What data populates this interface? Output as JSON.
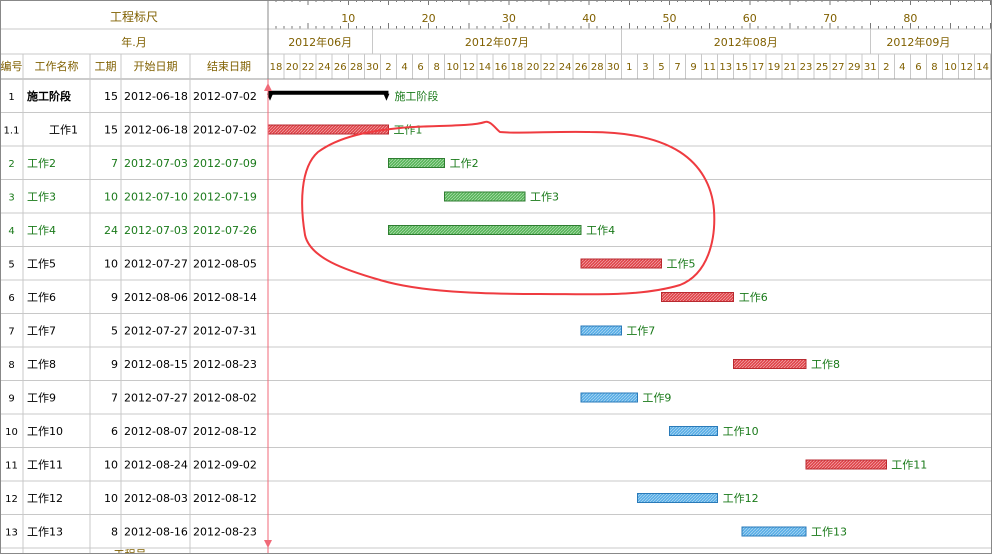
{
  "header": {
    "ruler_label": "工程标尺",
    "year_month_label": "年.月",
    "columns": [
      "编号",
      "工作名称",
      "工期",
      "开始日期",
      "结束日期"
    ]
  },
  "timeline": {
    "start_date": "2012-06-18",
    "ruler_ticks": [
      "10",
      "20",
      "30",
      "40",
      "50",
      "60",
      "70",
      "80"
    ],
    "months": [
      {
        "label": "2012年06月",
        "start": "2012-06-18",
        "end": "2012-06-30"
      },
      {
        "label": "2012年07月",
        "start": "2012-07-01",
        "end": "2012-07-31"
      },
      {
        "label": "2012年08月",
        "start": "2012-08-01",
        "end": "2012-08-31"
      },
      {
        "label": "2012年09月",
        "start": "2012-09-01",
        "end": "2012-09-12"
      }
    ]
  },
  "colors": {
    "header_text": "#806000",
    "critical": "#e0454b",
    "noncritical_green": "#58b65a",
    "free_blue": "#5aaee6",
    "summary": "#000000",
    "highlight_text": "#1a7a1a",
    "annotation": "#ef3b40",
    "grid": "#c8c8c8"
  },
  "chart_data": {
    "type": "gantt",
    "tasks": [
      {
        "id": "1",
        "name": "施工阶段",
        "duration": "15",
        "start": "2012-06-18",
        "end": "2012-07-02",
        "kind": "summary"
      },
      {
        "id": "1.1",
        "name": "工作1",
        "duration": "15",
        "start": "2012-06-18",
        "end": "2012-07-02",
        "kind": "critical"
      },
      {
        "id": "2",
        "name": "工作2",
        "duration": "7",
        "start": "2012-07-03",
        "end": "2012-07-09",
        "kind": "green"
      },
      {
        "id": "3",
        "name": "工作3",
        "duration": "10",
        "start": "2012-07-10",
        "end": "2012-07-19",
        "kind": "green"
      },
      {
        "id": "4",
        "name": "工作4",
        "duration": "24",
        "start": "2012-07-03",
        "end": "2012-07-26",
        "kind": "green"
      },
      {
        "id": "5",
        "name": "工作5",
        "duration": "10",
        "start": "2012-07-27",
        "end": "2012-08-05",
        "kind": "critical"
      },
      {
        "id": "6",
        "name": "工作6",
        "duration": "9",
        "start": "2012-08-06",
        "end": "2012-08-14",
        "kind": "critical"
      },
      {
        "id": "7",
        "name": "工作7",
        "duration": "5",
        "start": "2012-07-27",
        "end": "2012-07-31",
        "kind": "blue"
      },
      {
        "id": "8",
        "name": "工作8",
        "duration": "9",
        "start": "2012-08-15",
        "end": "2012-08-23",
        "kind": "critical"
      },
      {
        "id": "9",
        "name": "工作9",
        "duration": "7",
        "start": "2012-07-27",
        "end": "2012-08-02",
        "kind": "blue"
      },
      {
        "id": "10",
        "name": "工作10",
        "duration": "6",
        "start": "2012-08-07",
        "end": "2012-08-12",
        "kind": "blue"
      },
      {
        "id": "11",
        "name": "工作11",
        "duration": "10",
        "start": "2012-08-24",
        "end": "2012-09-02",
        "kind": "critical"
      },
      {
        "id": "12",
        "name": "工作12",
        "duration": "10",
        "start": "2012-08-03",
        "end": "2012-08-12",
        "kind": "blue"
      },
      {
        "id": "13",
        "name": "工作13",
        "duration": "8",
        "start": "2012-08-16",
        "end": "2012-08-23",
        "kind": "blue"
      }
    ]
  },
  "footer": {
    "partial_label": "工程号"
  }
}
